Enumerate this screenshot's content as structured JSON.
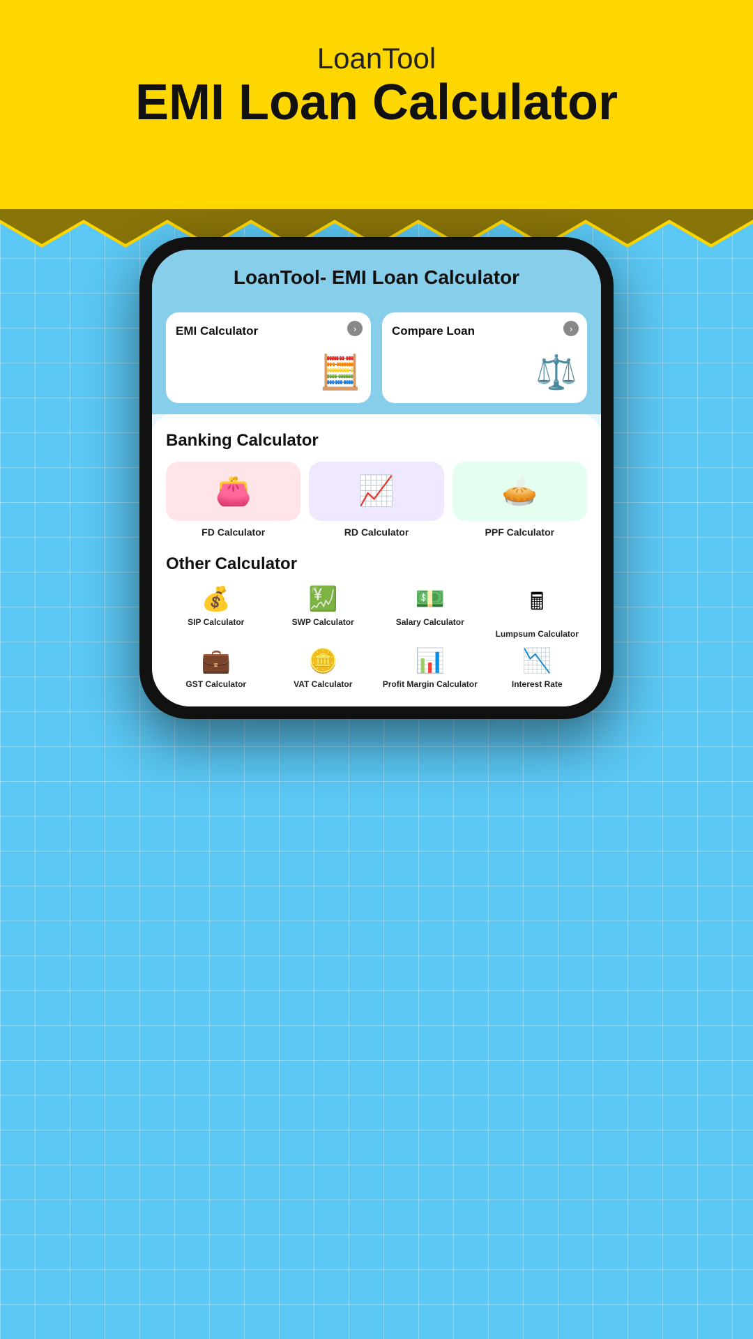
{
  "header": {
    "subtitle": "LoanTool",
    "title": "EMI Loan Calculator"
  },
  "app": {
    "title": "LoanTool- EMI Loan Calculator",
    "top_cards": [
      {
        "label": "EMI Calculator",
        "icon": "🧮",
        "arrow": "›"
      },
      {
        "label": "Compare Loan",
        "icon": "⚖️",
        "arrow": "›"
      }
    ],
    "banking_section": {
      "title": "Banking Calculator",
      "items": [
        {
          "label": "FD Calculator",
          "icon": "👛",
          "bg": "pink"
        },
        {
          "label": "RD Calculator",
          "icon": "📈",
          "bg": "lavender"
        },
        {
          "label": "PPF Calculator",
          "icon": "🥧",
          "bg": "mint"
        }
      ]
    },
    "other_section": {
      "title": "Other Calculator",
      "items": [
        {
          "label": "SIP Calculator",
          "icon": "💰"
        },
        {
          "label": "SWP Calculator",
          "icon": "💹"
        },
        {
          "label": "Salary Calculator",
          "icon": "💵"
        },
        {
          "label": "Lumpsum Calculator",
          "icon": "🖩"
        },
        {
          "label": "GST Calculator",
          "icon": "💼"
        },
        {
          "label": "VAT Calculator",
          "icon": "🪙"
        },
        {
          "label": "Profit Margin Calculator",
          "icon": "📊"
        },
        {
          "label": "Interest Rate",
          "icon": "📉"
        }
      ]
    }
  }
}
